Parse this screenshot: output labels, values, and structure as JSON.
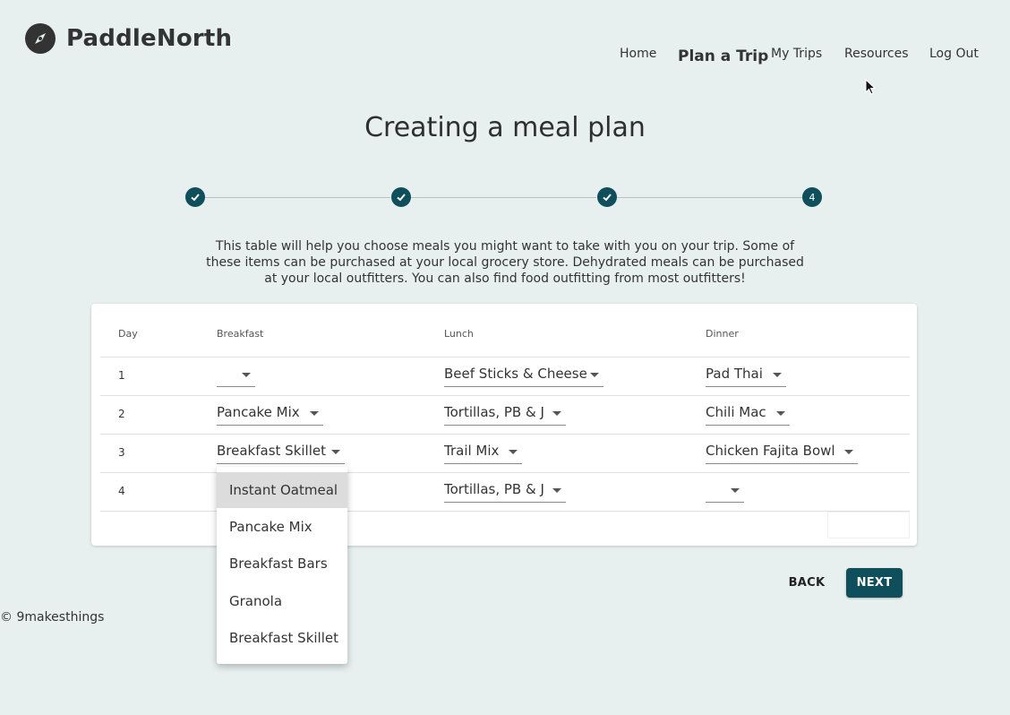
{
  "brand": {
    "name": "PaddleNorth",
    "icon": "compass-icon"
  },
  "nav": {
    "home": "Home",
    "plan": "Plan a Trip",
    "trips": "My Trips",
    "resources": "Resources",
    "logout": "Log Out"
  },
  "title": "Creating a meal plan",
  "stepper": {
    "steps": [
      "",
      "",
      "",
      "4"
    ],
    "completed": 3,
    "current_step": 4
  },
  "intro": "This table will help you choose meals you might want to take with you on your trip. Some of these items can be purchased at your local grocery store. Dehydrated meals can be purchased at your local outfitters. You can also find food outfitting from most outfitters!",
  "table": {
    "headers": {
      "day": "Day",
      "breakfast": "Breakfast",
      "lunch": "Lunch",
      "dinner": "Dinner"
    },
    "rows": [
      {
        "day": "1",
        "breakfast": "",
        "lunch": "Beef Sticks & Cheese",
        "dinner": "Pad Thai"
      },
      {
        "day": "2",
        "breakfast": "Pancake Mix",
        "lunch": "Tortillas, PB & J",
        "dinner": "Chili Mac"
      },
      {
        "day": "3",
        "breakfast": "Breakfast Skillet",
        "lunch": "Trail Mix",
        "dinner": "Chicken Fajita Bowl"
      },
      {
        "day": "4",
        "breakfast": "",
        "lunch": "Tortillas, PB & J",
        "dinner": ""
      }
    ]
  },
  "dropdown": {
    "options": [
      "Instant Oatmeal",
      "Pancake Mix",
      "Breakfast Bars",
      "Granola",
      "Breakfast Skillet"
    ],
    "highlighted": "Instant Oatmeal"
  },
  "buttons": {
    "back": "BACK",
    "next": "NEXT"
  },
  "footer": "© 9makesthings",
  "colors": {
    "accent": "#0f4f5c",
    "background": "#e7f0ee"
  }
}
